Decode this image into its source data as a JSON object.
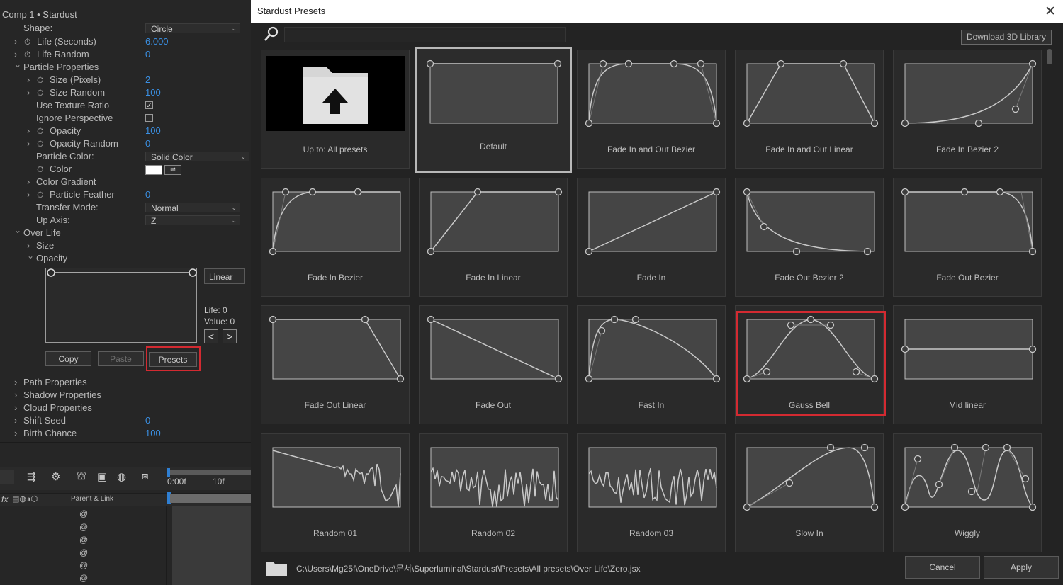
{
  "left_panel": {
    "title": "Comp 1 • Stardust",
    "rows": [
      {
        "label": "Shape:",
        "dropdown": "Circle"
      },
      {
        "label": "Life (Seconds)",
        "value": "6.000"
      },
      {
        "label": "Life Random",
        "value": "0"
      },
      {
        "label": "Particle Properties"
      },
      {
        "label": "Size (Pixels)",
        "value": "2"
      },
      {
        "label": "Size Random",
        "value": "100"
      },
      {
        "label": "Use Texture Ratio",
        "checked": true
      },
      {
        "label": "Ignore Perspective",
        "checked": false
      },
      {
        "label": "Opacity",
        "value": "100"
      },
      {
        "label": "Opacity Random",
        "value": "0"
      },
      {
        "label": "Particle Color:",
        "dropdown": "Solid Color"
      },
      {
        "label": "Color"
      },
      {
        "label": "Color Gradient"
      },
      {
        "label": "Particle Feather",
        "value": "0"
      },
      {
        "label": "Transfer Mode:",
        "dropdown": "Normal"
      },
      {
        "label": "Up Axis:",
        "dropdown": "Z"
      },
      {
        "label": "Over Life"
      },
      {
        "label": "Size"
      },
      {
        "label": "Opacity"
      },
      {
        "label": "Path Properties"
      },
      {
        "label": "Shadow Properties"
      },
      {
        "label": "Cloud Properties"
      },
      {
        "label": "Shift Seed",
        "value": "0"
      },
      {
        "label": "Birth Chance",
        "value": "100"
      }
    ],
    "graph_mode": "Linear",
    "life_info": "Life: 0",
    "value_info": "Value: 0",
    "prev_arrow": "<",
    "next_arrow": ">",
    "copy_label": "Copy",
    "paste_label": "Paste",
    "presets_label": "Presets"
  },
  "timeline": {
    "time_start": "0:00f",
    "time_10": "10f",
    "fx_label": "fx",
    "parent_link": "Parent & Link",
    "spiral_glyph": "@"
  },
  "dialog": {
    "title": "Stardust Presets",
    "close_glyph": "✕",
    "search_placeholder": "",
    "download_label": "Download 3D Library",
    "presets": [
      {
        "name": "Up to: All presets",
        "curve": "folder"
      },
      {
        "name": "Default",
        "curve": "default",
        "selected": true
      },
      {
        "name": "Fade In and Out Bezier",
        "curve": "fio_bezier"
      },
      {
        "name": "Fade In and Out Linear",
        "curve": "fio_linear"
      },
      {
        "name": "Fade In Bezier 2",
        "curve": "fib2"
      },
      {
        "name": "Fade In Bezier",
        "curve": "fib"
      },
      {
        "name": "Fade In Linear",
        "curve": "fil"
      },
      {
        "name": "Fade In",
        "curve": "fi"
      },
      {
        "name": "Fade Out Bezier 2",
        "curve": "fob2"
      },
      {
        "name": "Fade Out Bezier",
        "curve": "fob"
      },
      {
        "name": "Fade Out Linear",
        "curve": "fol"
      },
      {
        "name": "Fade Out",
        "curve": "fo"
      },
      {
        "name": "Fast In",
        "curve": "fastin"
      },
      {
        "name": "Gauss Bell",
        "curve": "gauss",
        "highlighted": true
      },
      {
        "name": "Mid linear",
        "curve": "mid"
      },
      {
        "name": "Random 01",
        "curve": "r1"
      },
      {
        "name": "Random 02",
        "curve": "r2"
      },
      {
        "name": "Random 03",
        "curve": "r3"
      },
      {
        "name": "Slow In",
        "curve": "slowin"
      },
      {
        "name": "Wiggly",
        "curve": "wiggly"
      }
    ],
    "path": "C:\\Users\\Mg25f\\OneDrive\\문서\\Superluminal\\Stardust\\Presets\\All presets\\Over Life\\Zero.jsx",
    "cancel_label": "Cancel",
    "apply_label": "Apply"
  },
  "colors": {
    "accent_blue": "#3a8fe2",
    "highlight_red": "#d32a31",
    "panel_bg": "#262626",
    "card_bg": "#2a2a2a"
  }
}
